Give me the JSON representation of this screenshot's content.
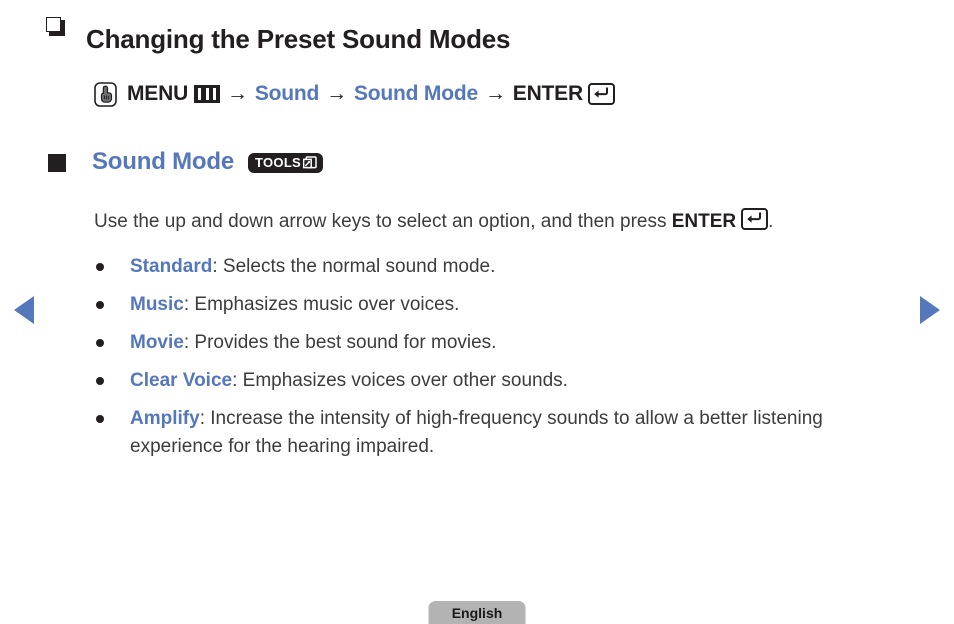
{
  "page": {
    "section_title": "Changing the Preset Sound Modes",
    "menu_path": {
      "press_icon": "hand-press-icon",
      "menu_label": "MENU",
      "menu_icon": "menu-bars-icon",
      "arrow1": "→",
      "step1": "Sound",
      "arrow2": "→",
      "step2": "Sound Mode",
      "arrow3": "→",
      "enter_label": "ENTER",
      "enter_icon": "enter-key-icon"
    },
    "sub_heading": {
      "bullet_icon": "filled-square-icon",
      "label": "Sound Mode",
      "badge": "TOOLS",
      "badge_icon": "tools-popup-icon"
    },
    "description": {
      "before": "Use the up and down arrow keys to select an option, and then press ",
      "enter_label": "ENTER",
      "enter_icon": "enter-key-icon",
      "after": "."
    },
    "options": [
      {
        "term": "Standard",
        "desc": ": Selects the normal sound mode."
      },
      {
        "term": "Music",
        "desc": ": Emphasizes music over voices."
      },
      {
        "term": "Movie",
        "desc": ": Provides the best sound for movies."
      },
      {
        "term": "Clear Voice",
        "desc": ": Emphasizes voices over other sounds."
      },
      {
        "term": "Amplify",
        "desc": ": Increase the intensity of high-frequency sounds to allow a better listening experience for the hearing impaired."
      }
    ],
    "nav": {
      "prev_icon": "previous-page-arrow-icon",
      "next_icon": "next-page-arrow-icon"
    },
    "footer": {
      "language": "English"
    },
    "colors": {
      "accent_blue": "#5577bb",
      "text_black": "#231f20",
      "body_gray": "#3c3c3c",
      "footer_gray": "#b3b3b3"
    }
  }
}
